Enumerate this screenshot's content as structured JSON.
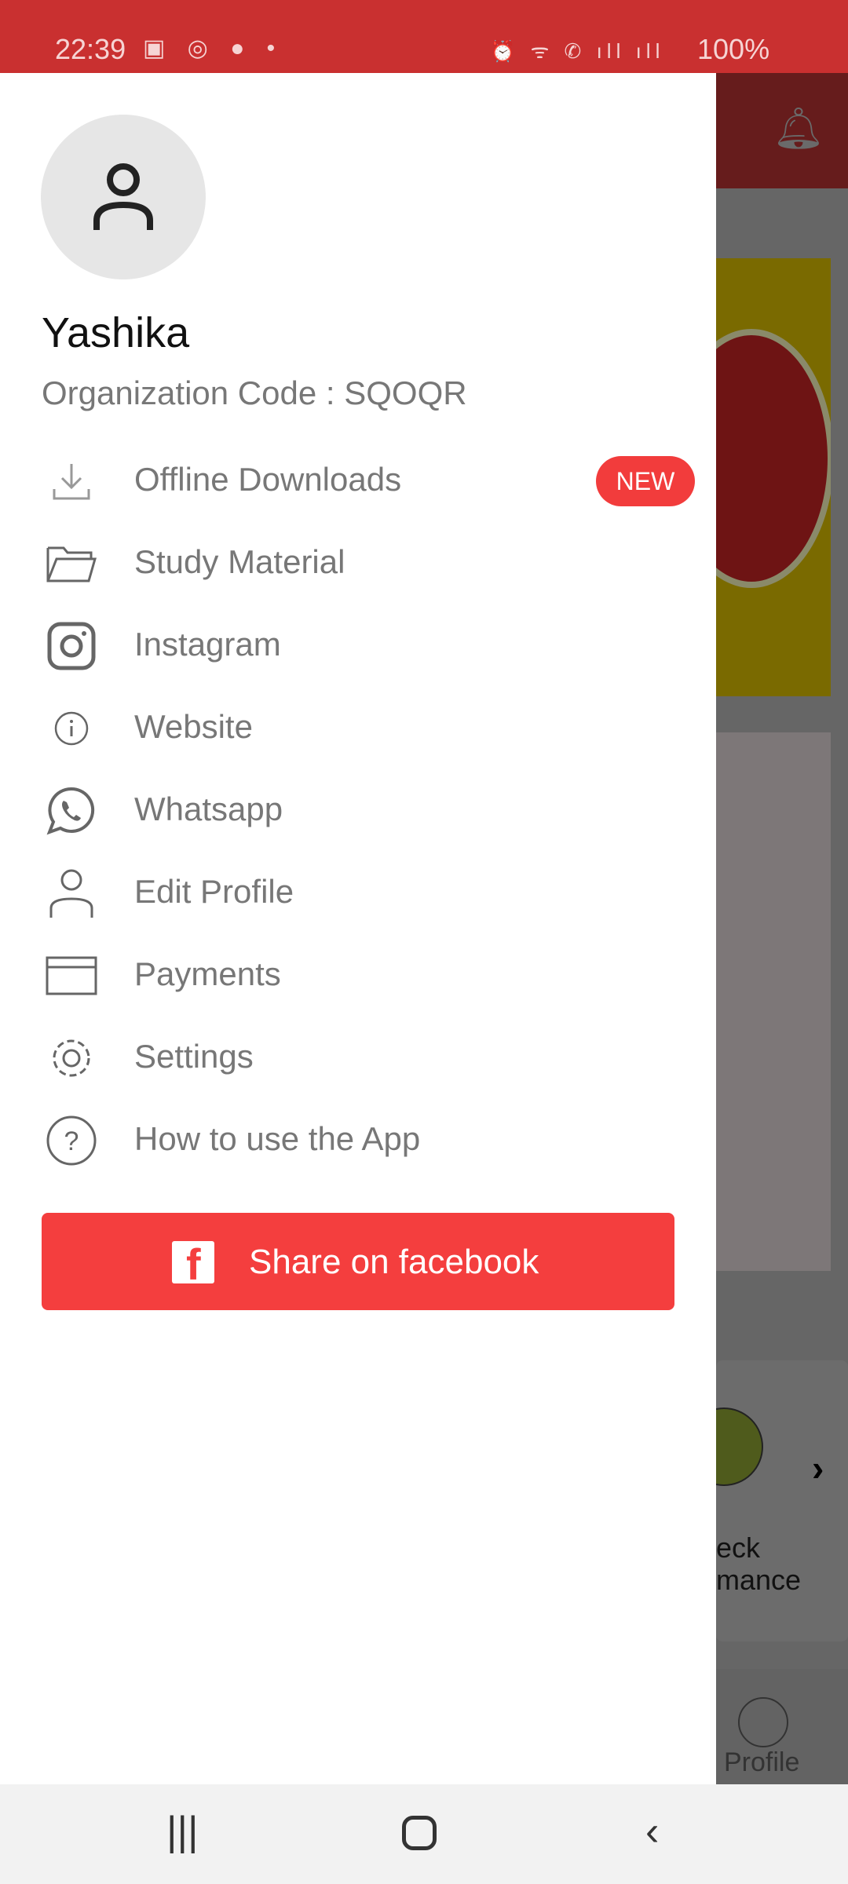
{
  "status_bar": {
    "time": "22:39",
    "battery": "100%",
    "left_icons": [
      "gallery-icon",
      "whatsapp-icon",
      "message-icon",
      "dot-icon"
    ],
    "right_icons": [
      "alarm-icon",
      "wifi-icon",
      "wifi-call-icon",
      "signal-icon",
      "volte-lte2-icon",
      "signal-icon",
      "battery-icon"
    ]
  },
  "drawer": {
    "user_name": "Yashika",
    "org_code": "Organization Code :  SQOQR",
    "items": [
      {
        "label": "Offline Downloads",
        "icon": "download-icon",
        "badge": "NEW"
      },
      {
        "label": "Study Material",
        "icon": "folder-icon"
      },
      {
        "label": "Instagram",
        "icon": "instagram-icon"
      },
      {
        "label": "Website",
        "icon": "info-icon"
      },
      {
        "label": "Whatsapp",
        "icon": "whatsapp-icon"
      },
      {
        "label": "Edit Profile",
        "icon": "person-icon"
      },
      {
        "label": "Payments",
        "icon": "card-icon"
      },
      {
        "label": "Settings",
        "icon": "gear-icon"
      },
      {
        "label": "How to use the App",
        "icon": "help-icon"
      }
    ],
    "share_button": "Share on facebook"
  },
  "background": {
    "card_text_1": "eck",
    "card_text_2": "mance",
    "nav_profile": "Profile"
  },
  "colors": {
    "accent": "#f43e3e",
    "status_bar": "#c93030"
  }
}
